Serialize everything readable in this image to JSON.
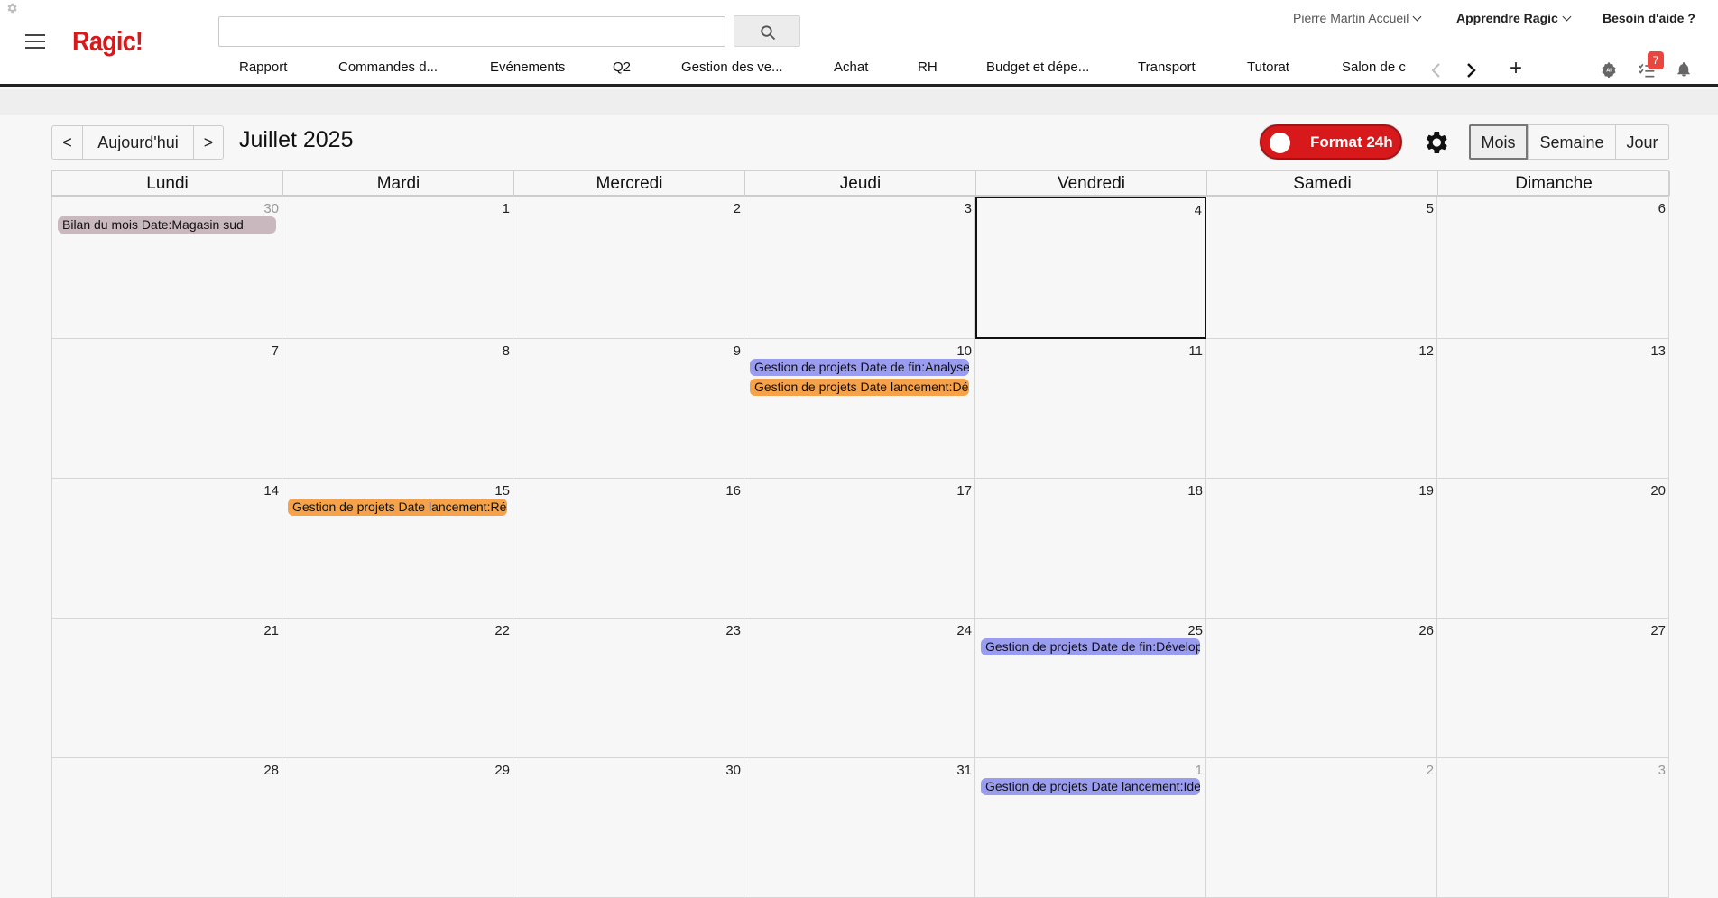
{
  "header": {
    "logo": "Ragic!",
    "search": {
      "value": "",
      "placeholder": ""
    },
    "user_menu": "Pierre Martin Accueil",
    "learn_menu": "Apprendre Ragic",
    "help_link": "Besoin d'aide ?",
    "tasks_badge": "7",
    "tabs": [
      {
        "label": "Rapport"
      },
      {
        "label": "Commandes d..."
      },
      {
        "label": "Evénements"
      },
      {
        "label": "Q2"
      },
      {
        "label": "Gestion des ve..."
      },
      {
        "label": "Achat"
      },
      {
        "label": "RH"
      },
      {
        "label": "Budget et dépe..."
      },
      {
        "label": "Transport"
      },
      {
        "label": "Tutorat"
      },
      {
        "label": "Salon de c"
      }
    ],
    "add_tab": "+",
    "icons": [
      "menu-icon",
      "search-icon",
      "chevron-left-icon",
      "chevron-right-icon",
      "plus-icon",
      "apps-icon",
      "tasks-icon",
      "bell-icon"
    ]
  },
  "toolbar": {
    "prev": "<",
    "today": "Aujourd'hui",
    "next": ">",
    "title": "Juillet 2025",
    "format_toggle": "Format 24h",
    "views": {
      "month": "Mois",
      "week": "Semaine",
      "day": "Jour"
    },
    "active_view": "Mois"
  },
  "calendar": {
    "weekdays": [
      "Lundi",
      "Mardi",
      "Mercredi",
      "Jeudi",
      "Vendredi",
      "Samedi",
      "Dimanche"
    ],
    "weeks": [
      [
        "30",
        "1",
        "2",
        "3",
        "4",
        "5",
        "6"
      ],
      [
        "7",
        "8",
        "9",
        "10",
        "11",
        "12",
        "13"
      ],
      [
        "14",
        "15",
        "16",
        "17",
        "18",
        "19",
        "20"
      ],
      [
        "21",
        "22",
        "23",
        "24",
        "25",
        "26",
        "27"
      ],
      [
        "28",
        "29",
        "30",
        "31",
        "1",
        "2",
        "3"
      ]
    ],
    "today": "4",
    "events": {
      "w0d0": [
        {
          "label": "Bilan du mois Date:Magasin sud",
          "color": "#c9b9be"
        }
      ],
      "w1d3": [
        {
          "label": "Gestion de projets Date de fin:Analyse",
          "color": "#9a9cf0"
        },
        {
          "label": "Gestion de projets Date lancement:Dé",
          "color": "#f6a24a"
        }
      ],
      "w2d1": [
        {
          "label": "Gestion de projets Date lancement:Ré",
          "color": "#f6a24a"
        }
      ],
      "w3d4": [
        {
          "label": "Gestion de projets Date de fin:Dévelop",
          "color": "#9a9cf0"
        }
      ],
      "w4d4": [
        {
          "label": "Gestion de projets Date lancement:Ide",
          "color": "#9a9cf0"
        }
      ]
    }
  },
  "colors": {
    "brand": "#d7191b",
    "event_purple": "#9a9cf0",
    "event_orange": "#f6a24a",
    "event_mauve": "#c9b9be",
    "badge": "#e8463f"
  }
}
